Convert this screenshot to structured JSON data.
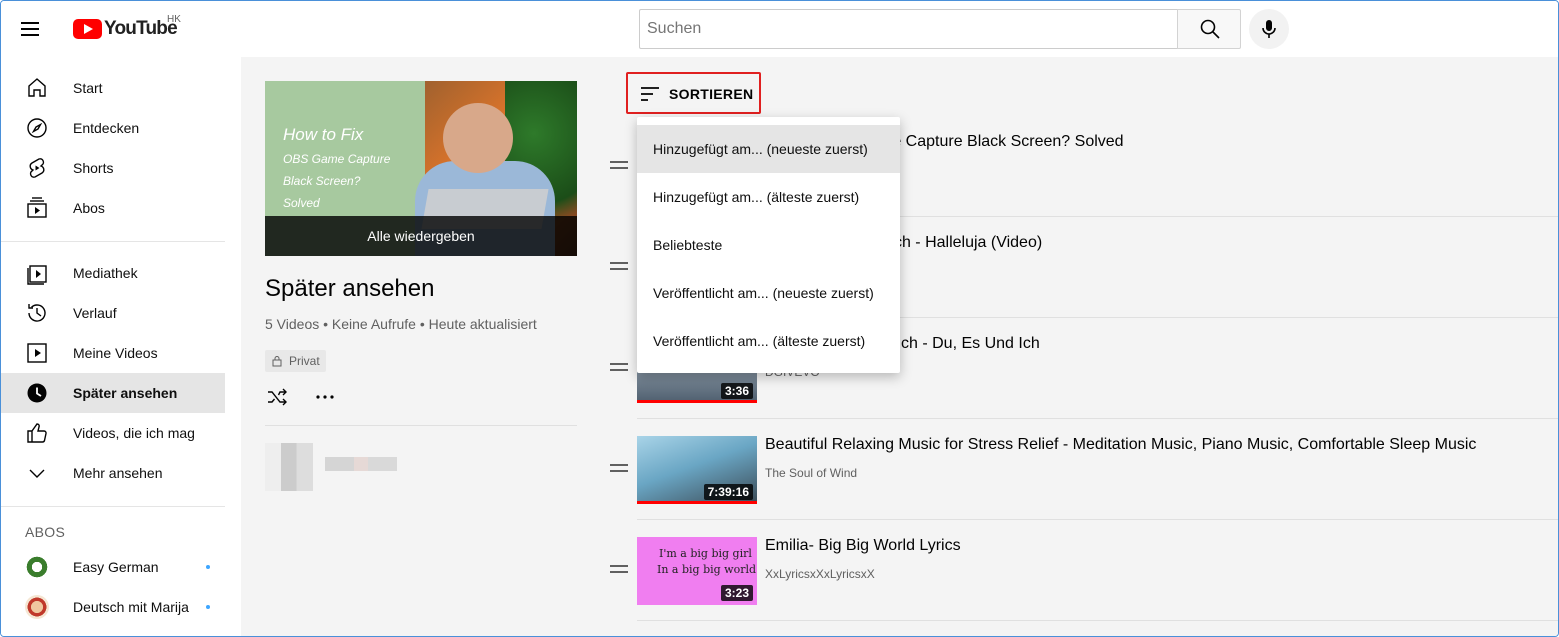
{
  "header": {
    "logo_text": "YouTube",
    "region": "HK",
    "search_placeholder": "Suchen"
  },
  "sidebar": {
    "main": [
      {
        "label": "Start",
        "icon": "home-icon"
      },
      {
        "label": "Entdecken",
        "icon": "compass-icon"
      },
      {
        "label": "Shorts",
        "icon": "shorts-icon"
      },
      {
        "label": "Abos",
        "icon": "subscriptions-icon"
      }
    ],
    "library": [
      {
        "label": "Mediathek",
        "icon": "library-icon"
      },
      {
        "label": "Verlauf",
        "icon": "history-icon"
      },
      {
        "label": "Meine Videos",
        "icon": "your-videos-icon"
      },
      {
        "label": "Später ansehen",
        "icon": "clock-icon",
        "active": true
      },
      {
        "label": "Videos, die ich mag",
        "icon": "thumbs-up-icon"
      },
      {
        "label": "Mehr ansehen",
        "icon": "chevron-down-icon"
      }
    ],
    "subs_heading": "ABOS",
    "subs": [
      {
        "label": "Easy German",
        "new": true
      },
      {
        "label": "Deutsch mit Marija",
        "new": true
      }
    ]
  },
  "playlist": {
    "thumb_lines": [
      "How to Fix",
      "OBS Game Capture",
      "Black Screen?",
      "Solved"
    ],
    "play_all": "Alle wiedergeben",
    "title": "Später ansehen",
    "stats": "5 Videos • Keine Aufrufe • Heute aktualisiert",
    "privacy": "Privat"
  },
  "sort": {
    "label": "SORTIEREN",
    "options": [
      "Hinzugefügt am... (neueste zuerst)",
      "Hinzugefügt am... (älteste zuerst)",
      "Beliebteste",
      "Veröffentlicht am... (neueste zuerst)",
      "Veröffentlicht am... (älteste zuerst)"
    ],
    "highlighted_index": 0
  },
  "videos": [
    {
      "title": "How to Fix OBS Game Capture Black Screen? Solved",
      "channel": "",
      "duration": "",
      "visible_title": "me Capture Black Screen? Solved",
      "thumb_color": "#c7d3c0"
    },
    {
      "title": "Der Gezeichnete Ich - Halleluja (Video)",
      "channel": "",
      "duration": "",
      "visible_title": "Der Gezeichnete Ich - Halleluja (Video)",
      "thumb_color": "#d9d9d9"
    },
    {
      "title": "Der Gezeichnete Ich - Du, Es Und Ich",
      "channel": "DGIVEVO",
      "duration": "3:36",
      "visible_title": "ch - Du, Es Und Ich",
      "thumb_color": "#8a9fb3"
    },
    {
      "title": "Beautiful Relaxing Music for Stress Relief - Meditation Music, Piano Music, Comfortable Sleep Music",
      "channel": "The Soul of Wind",
      "duration": "7:39:16",
      "visible_title": "Beautiful Relaxing Music for Stress Relief - Meditation Music, Piano Music, Comfortable Sleep Music",
      "thumb_color": "#5f8fa8"
    },
    {
      "title": "Emilia- Big Big World Lyrics",
      "channel": "XxLyricsxXxLyricsxX",
      "duration": "3:23",
      "visible_title": "Emilia- Big Big World Lyrics",
      "thumb_color": "#f07ef0",
      "thumb_text": [
        "I'm a big big girl",
        "In a big big world"
      ]
    }
  ]
}
